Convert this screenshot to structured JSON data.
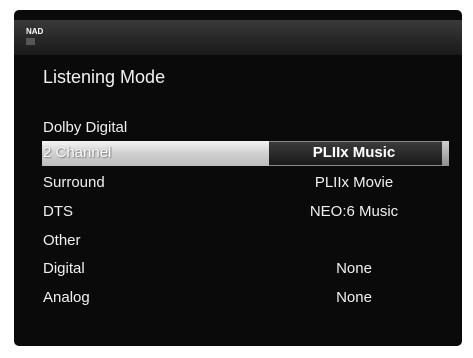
{
  "header": {
    "brand": "NAD"
  },
  "page": {
    "title": "Listening Mode"
  },
  "menu": {
    "items": [
      {
        "label": "Dolby Digital",
        "value": ""
      },
      {
        "label": "2 Channel",
        "value": "PLIIx Music"
      },
      {
        "label": "Surround",
        "value": "PLIIx Movie"
      },
      {
        "label": "DTS",
        "value": "NEO:6 Music"
      },
      {
        "label": "Other",
        "value": ""
      },
      {
        "label": "Digital",
        "value": "None"
      },
      {
        "label": "Analog",
        "value": "None"
      }
    ],
    "selected_index": 1
  }
}
